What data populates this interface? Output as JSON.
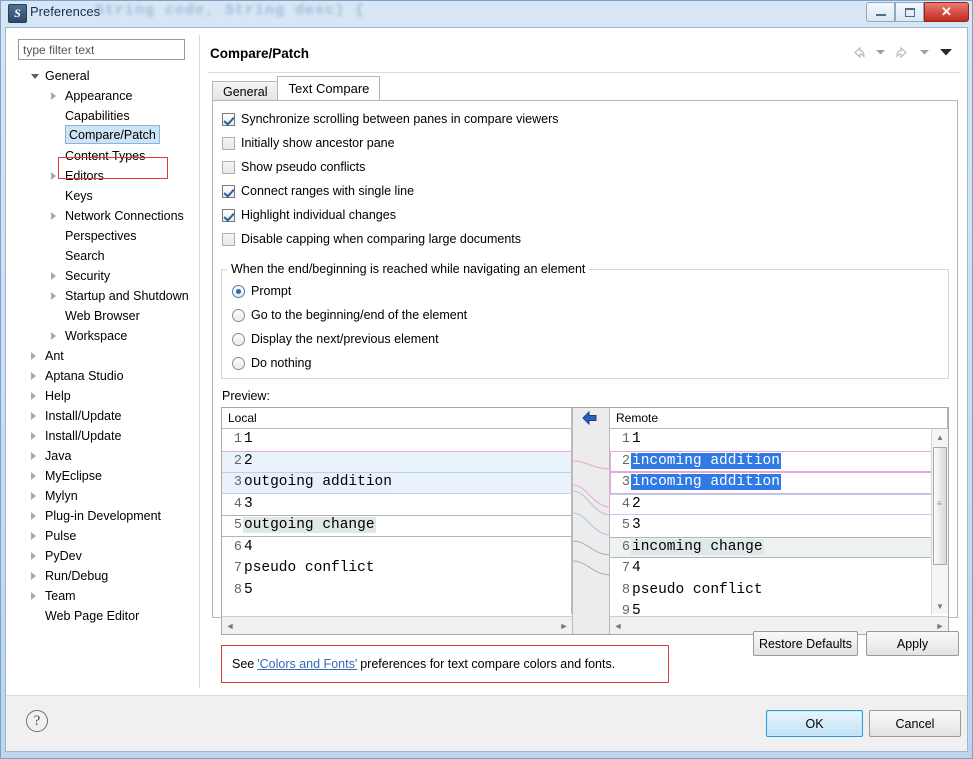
{
  "window": {
    "title": "Preferences",
    "icon": "eclipse-icon",
    "background_code_text": "String code, String desc) {",
    "buttons": {
      "minimize": "minimize-icon",
      "maximize": "maximize-icon",
      "close": "✕"
    }
  },
  "sidebar": {
    "filter_placeholder": "type filter text",
    "filter_value": "",
    "scroll_grip": "III",
    "items": [
      {
        "label": "General",
        "depth": 0,
        "expander": "open",
        "selected": false
      },
      {
        "label": "Appearance",
        "depth": 1,
        "expander": "closed",
        "selected": false
      },
      {
        "label": "Capabilities",
        "depth": 1,
        "expander": "none",
        "selected": false
      },
      {
        "label": "Compare/Patch",
        "depth": 1,
        "expander": "none",
        "selected": true
      },
      {
        "label": "Content Types",
        "depth": 1,
        "expander": "none",
        "selected": false
      },
      {
        "label": "Editors",
        "depth": 1,
        "expander": "closed",
        "selected": false
      },
      {
        "label": "Keys",
        "depth": 1,
        "expander": "none",
        "selected": false
      },
      {
        "label": "Network Connections",
        "depth": 1,
        "expander": "closed",
        "selected": false
      },
      {
        "label": "Perspectives",
        "depth": 1,
        "expander": "none",
        "selected": false
      },
      {
        "label": "Search",
        "depth": 1,
        "expander": "none",
        "selected": false
      },
      {
        "label": "Security",
        "depth": 1,
        "expander": "closed",
        "selected": false
      },
      {
        "label": "Startup and Shutdown",
        "depth": 1,
        "expander": "closed",
        "selected": false
      },
      {
        "label": "Web Browser",
        "depth": 1,
        "expander": "none",
        "selected": false
      },
      {
        "label": "Workspace",
        "depth": 1,
        "expander": "closed",
        "selected": false
      },
      {
        "label": "Ant",
        "depth": 0,
        "expander": "closed",
        "selected": false
      },
      {
        "label": "Aptana Studio",
        "depth": 0,
        "expander": "closed",
        "selected": false
      },
      {
        "label": "Help",
        "depth": 0,
        "expander": "closed",
        "selected": false
      },
      {
        "label": "Install/Update",
        "depth": 0,
        "expander": "closed",
        "selected": false
      },
      {
        "label": "Install/Update",
        "depth": 0,
        "expander": "closed",
        "selected": false
      },
      {
        "label": "Java",
        "depth": 0,
        "expander": "closed",
        "selected": false
      },
      {
        "label": "MyEclipse",
        "depth": 0,
        "expander": "closed",
        "selected": false
      },
      {
        "label": "Mylyn",
        "depth": 0,
        "expander": "closed",
        "selected": false
      },
      {
        "label": "Plug-in Development",
        "depth": 0,
        "expander": "closed",
        "selected": false
      },
      {
        "label": "Pulse",
        "depth": 0,
        "expander": "closed",
        "selected": false
      },
      {
        "label": "PyDev",
        "depth": 0,
        "expander": "closed",
        "selected": false
      },
      {
        "label": "Run/Debug",
        "depth": 0,
        "expander": "closed",
        "selected": false
      },
      {
        "label": "Team",
        "depth": 0,
        "expander": "closed",
        "selected": false
      },
      {
        "label": "Web Page Editor",
        "depth": 0,
        "expander": "none",
        "selected": false
      }
    ]
  },
  "page": {
    "title": "Compare/Patch",
    "nav": [
      "back-icon",
      "back-dropdown-icon",
      "forward-icon",
      "forward-dropdown-icon",
      "menu-dropdown-icon"
    ],
    "tabs": [
      {
        "label": "General",
        "active": false
      },
      {
        "label": "Text Compare",
        "active": true
      }
    ],
    "checkboxes": [
      {
        "label": "Synchronize scrolling between panes in compare viewers",
        "checked": true
      },
      {
        "label": "Initially show ancestor pane",
        "checked": false
      },
      {
        "label": "Show pseudo conflicts",
        "checked": false
      },
      {
        "label": "Connect ranges with single line",
        "checked": true
      },
      {
        "label": "Highlight individual changes",
        "checked": true
      },
      {
        "label": "Disable capping when comparing large documents",
        "checked": false
      }
    ],
    "radio_group": {
      "legend": "When the end/beginning is reached while navigating an element",
      "options": [
        {
          "label": "Prompt",
          "selected": true
        },
        {
          "label": "Go to the beginning/end of the element",
          "selected": false
        },
        {
          "label": "Display the next/previous element",
          "selected": false
        },
        {
          "label": "Do nothing",
          "selected": false
        }
      ]
    },
    "preview": {
      "label": "Preview:",
      "left_pane": {
        "header": "Local",
        "lines": [
          {
            "no": "1",
            "text": "1",
            "style": "none"
          },
          {
            "no": "2",
            "text": "2",
            "style": "add-band-top"
          },
          {
            "no": "3",
            "text": "outgoing addition",
            "style": "add-outgoing"
          },
          {
            "no": "4",
            "text": "3",
            "style": "none"
          },
          {
            "no": "5",
            "text": "outgoing change",
            "style": "chg-outgoing"
          },
          {
            "no": "6",
            "text": "4",
            "style": "none"
          },
          {
            "no": "7",
            "text": "pseudo conflict",
            "style": "none"
          },
          {
            "no": "8",
            "text": "5",
            "style": "none"
          }
        ]
      },
      "right_pane": {
        "header": "Remote",
        "lines": [
          {
            "no": "1",
            "text": "1",
            "style": "none"
          },
          {
            "no": "2",
            "text": "incoming addition",
            "style": "add-incoming"
          },
          {
            "no": "3",
            "text": "incoming addition",
            "style": "add-incoming"
          },
          {
            "no": "4",
            "text": "2",
            "style": "band-blue"
          },
          {
            "no": "5",
            "text": "3",
            "style": "none"
          },
          {
            "no": "6",
            "text": "incoming change",
            "style": "chg-incoming"
          },
          {
            "no": "7",
            "text": "4",
            "style": "none"
          },
          {
            "no": "8",
            "text": "pseudo conflict",
            "style": "none"
          },
          {
            "no": "9",
            "text": "5",
            "style": "none"
          }
        ]
      },
      "connector_icon": "copy-left-arrow-icon"
    },
    "info": {
      "prefix": "See ",
      "link": "'Colors and Fonts'",
      "suffix": " preferences for text compare colors and fonts."
    },
    "restore_defaults_label": "Restore Defaults",
    "apply_label": "Apply"
  },
  "footer": {
    "help_icon": "?",
    "ok_label": "OK",
    "cancel_label": "Cancel"
  },
  "colors": {
    "selection_outline": "#e0393e",
    "incoming_addition": "#2f7ae5",
    "pink_marker": "#e6a8d8",
    "link": "#3569b0"
  }
}
